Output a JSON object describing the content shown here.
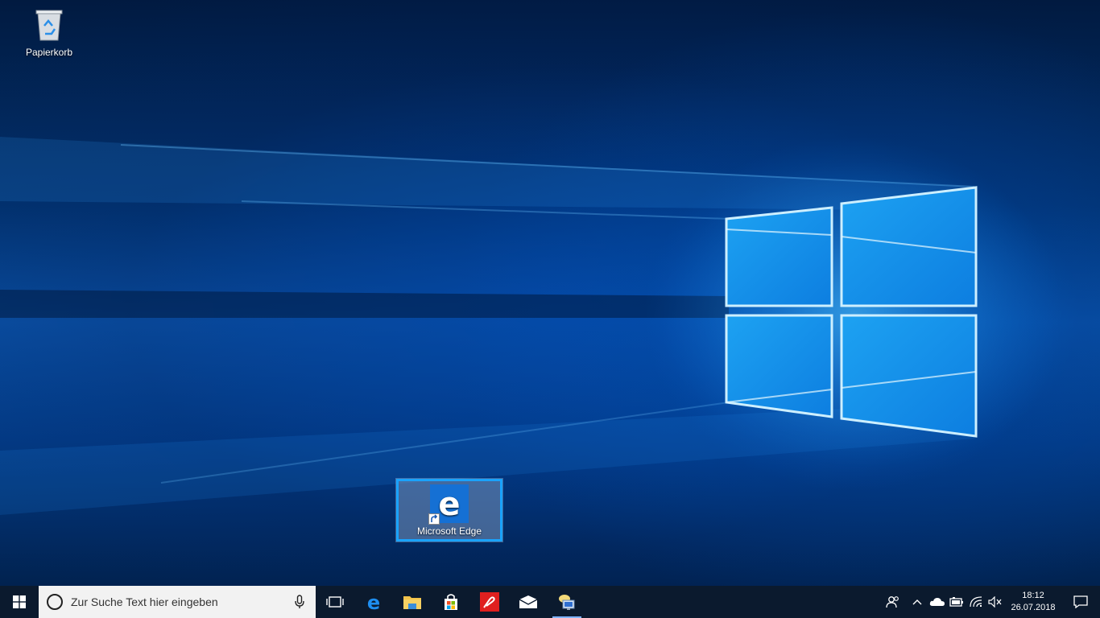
{
  "desktop": {
    "icons": [
      {
        "label": "Papierkorb",
        "icon": "recycle-bin-icon"
      },
      {
        "label": "Microsoft Edge",
        "icon": "edge-icon"
      }
    ]
  },
  "taskbar": {
    "start_icon": "windows-logo-icon",
    "search": {
      "placeholder": "Zur Suche Text hier eingeben"
    },
    "pinned": [
      {
        "name": "task-view",
        "icon": "task-view-icon"
      },
      {
        "name": "edge",
        "icon": "edge-icon"
      },
      {
        "name": "file-explorer",
        "icon": "folder-icon"
      },
      {
        "name": "store",
        "icon": "store-icon"
      },
      {
        "name": "pdf-app",
        "icon": "pdf-icon"
      },
      {
        "name": "mail",
        "icon": "mail-icon"
      },
      {
        "name": "network-app",
        "icon": "network-app-icon"
      }
    ],
    "tray": {
      "icons": [
        "people-icon",
        "chevron-up-icon",
        "onedrive-icon",
        "battery-icon",
        "wifi-icon",
        "volume-muted-icon"
      ],
      "time": "18:12",
      "date": "26.07.2018"
    }
  },
  "colors": {
    "taskbar_bg": "#0b1a2e",
    "accent": "#1aa3ff",
    "edge_blue": "#1570d4"
  }
}
